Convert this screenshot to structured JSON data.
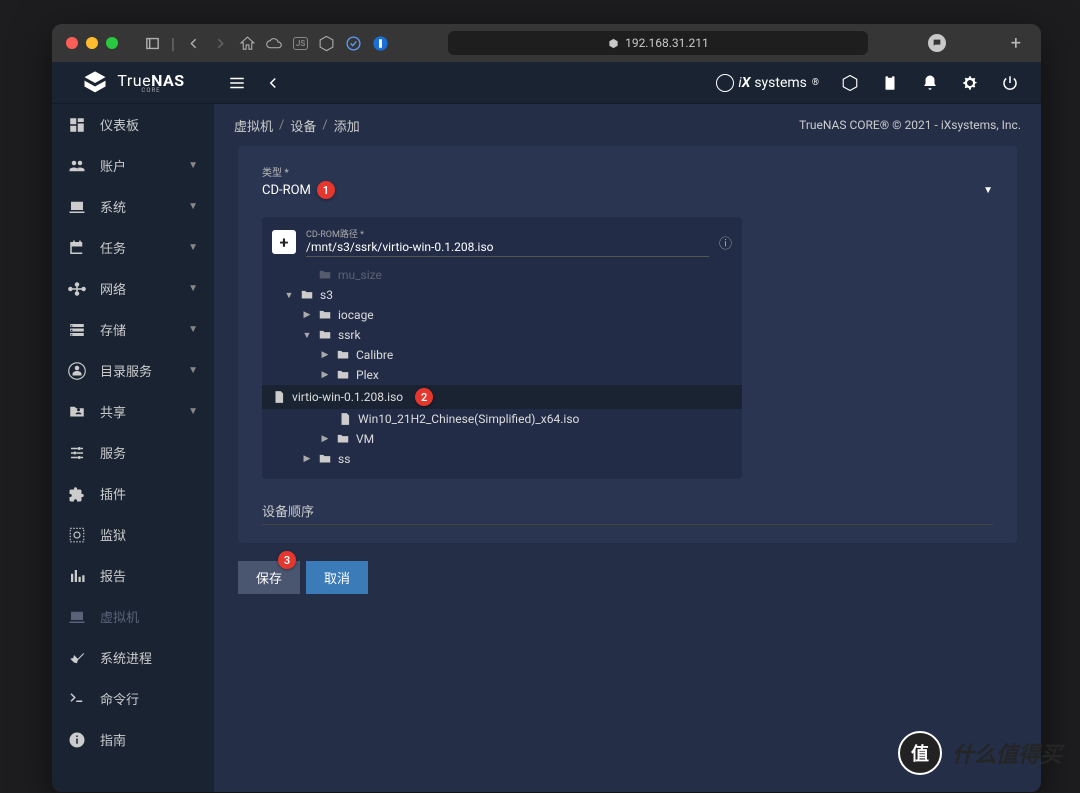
{
  "browser": {
    "url": "192.168.31.211"
  },
  "brand": {
    "name": "TrueNAS",
    "sub": "CORE"
  },
  "ix": {
    "name": "systems"
  },
  "copyright": "TrueNAS CORE® © 2021 - iXsystems, Inc.",
  "breadcrumb": {
    "a": "虚拟机",
    "b": "设备",
    "c": "添加"
  },
  "nav": [
    {
      "label": "仪表板",
      "icon": "dashboard",
      "expand": false
    },
    {
      "label": "账户",
      "icon": "group",
      "expand": true
    },
    {
      "label": "系统",
      "icon": "laptop",
      "expand": true
    },
    {
      "label": "任务",
      "icon": "calendar",
      "expand": true
    },
    {
      "label": "网络",
      "icon": "network",
      "expand": true
    },
    {
      "label": "存储",
      "icon": "storage",
      "expand": true
    },
    {
      "label": "目录服务",
      "icon": "contacts",
      "expand": true
    },
    {
      "label": "共享",
      "icon": "folder-shared",
      "expand": true
    },
    {
      "label": "服务",
      "icon": "tune",
      "expand": false
    },
    {
      "label": "插件",
      "icon": "extension",
      "expand": false
    },
    {
      "label": "监狱",
      "icon": "jail",
      "expand": false
    },
    {
      "label": "报告",
      "icon": "chart",
      "expand": false
    },
    {
      "label": "虚拟机",
      "icon": "laptop",
      "expand": false,
      "disabled": true
    },
    {
      "label": "系统进程",
      "icon": "wrench",
      "expand": false
    },
    {
      "label": "命令行",
      "icon": "terminal",
      "expand": false
    },
    {
      "label": "指南",
      "icon": "info",
      "expand": false
    }
  ],
  "form": {
    "type_label": "类型 *",
    "type_value": "CD-ROM",
    "path_label": "CD-ROM路径 *",
    "path_value": "/mnt/s3/ssrk/virtio-win-0.1.208.iso",
    "order_label": "设备顺序"
  },
  "tree": {
    "cutoff": "mu_size",
    "s3": "s3",
    "iocage": "iocage",
    "ssrk": "ssrk",
    "calibre": "Calibre",
    "plex": "Plex",
    "virtio": "virtio-win-0.1.208.iso",
    "win10": "Win10_21H2_Chinese(Simplified)_x64.iso",
    "vm": "VM",
    "ss": "ss"
  },
  "buttons": {
    "save": "保存",
    "cancel": "取消"
  },
  "annotations": {
    "a1": "1",
    "a2": "2",
    "a3": "3"
  },
  "watermark": {
    "badge": "值",
    "text": "什么值得买"
  }
}
